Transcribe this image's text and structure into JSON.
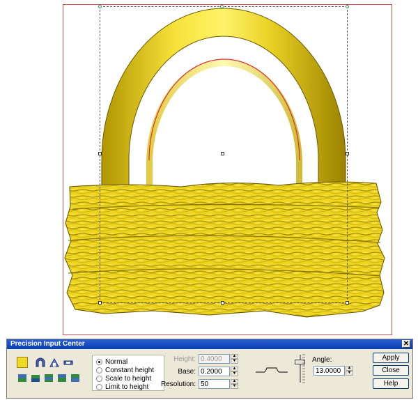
{
  "dialog": {
    "title": "Precision Input Center",
    "close_glyph": "✕",
    "tool_icons": [
      "color-swatch-icon",
      "arch-shape-icon",
      "dome-shape-icon",
      "flat-shape-icon",
      "layer-bottom-icon",
      "layer-down-icon",
      "layer-stack-icon",
      "layer-up-icon",
      "layer-top-icon"
    ],
    "modes": {
      "options": [
        "Normal",
        "Constant height",
        "Scale to height",
        "Limit to height"
      ],
      "selected": "Normal"
    },
    "height": {
      "label": "Height:",
      "value": "0.4000",
      "disabled": true
    },
    "base": {
      "label": "Base:",
      "value": "0.2000"
    },
    "resolution": {
      "label": "Resolution:",
      "value": "50"
    },
    "angle": {
      "label": "Angle:",
      "value": "13.0000"
    },
    "buttons": {
      "apply": "Apply",
      "close": "Close",
      "help": "Help"
    }
  },
  "colors": {
    "accent_yellow": "#f2d92a",
    "title_blue": "#0a3fb0",
    "frame_red": "#d24a4a"
  }
}
